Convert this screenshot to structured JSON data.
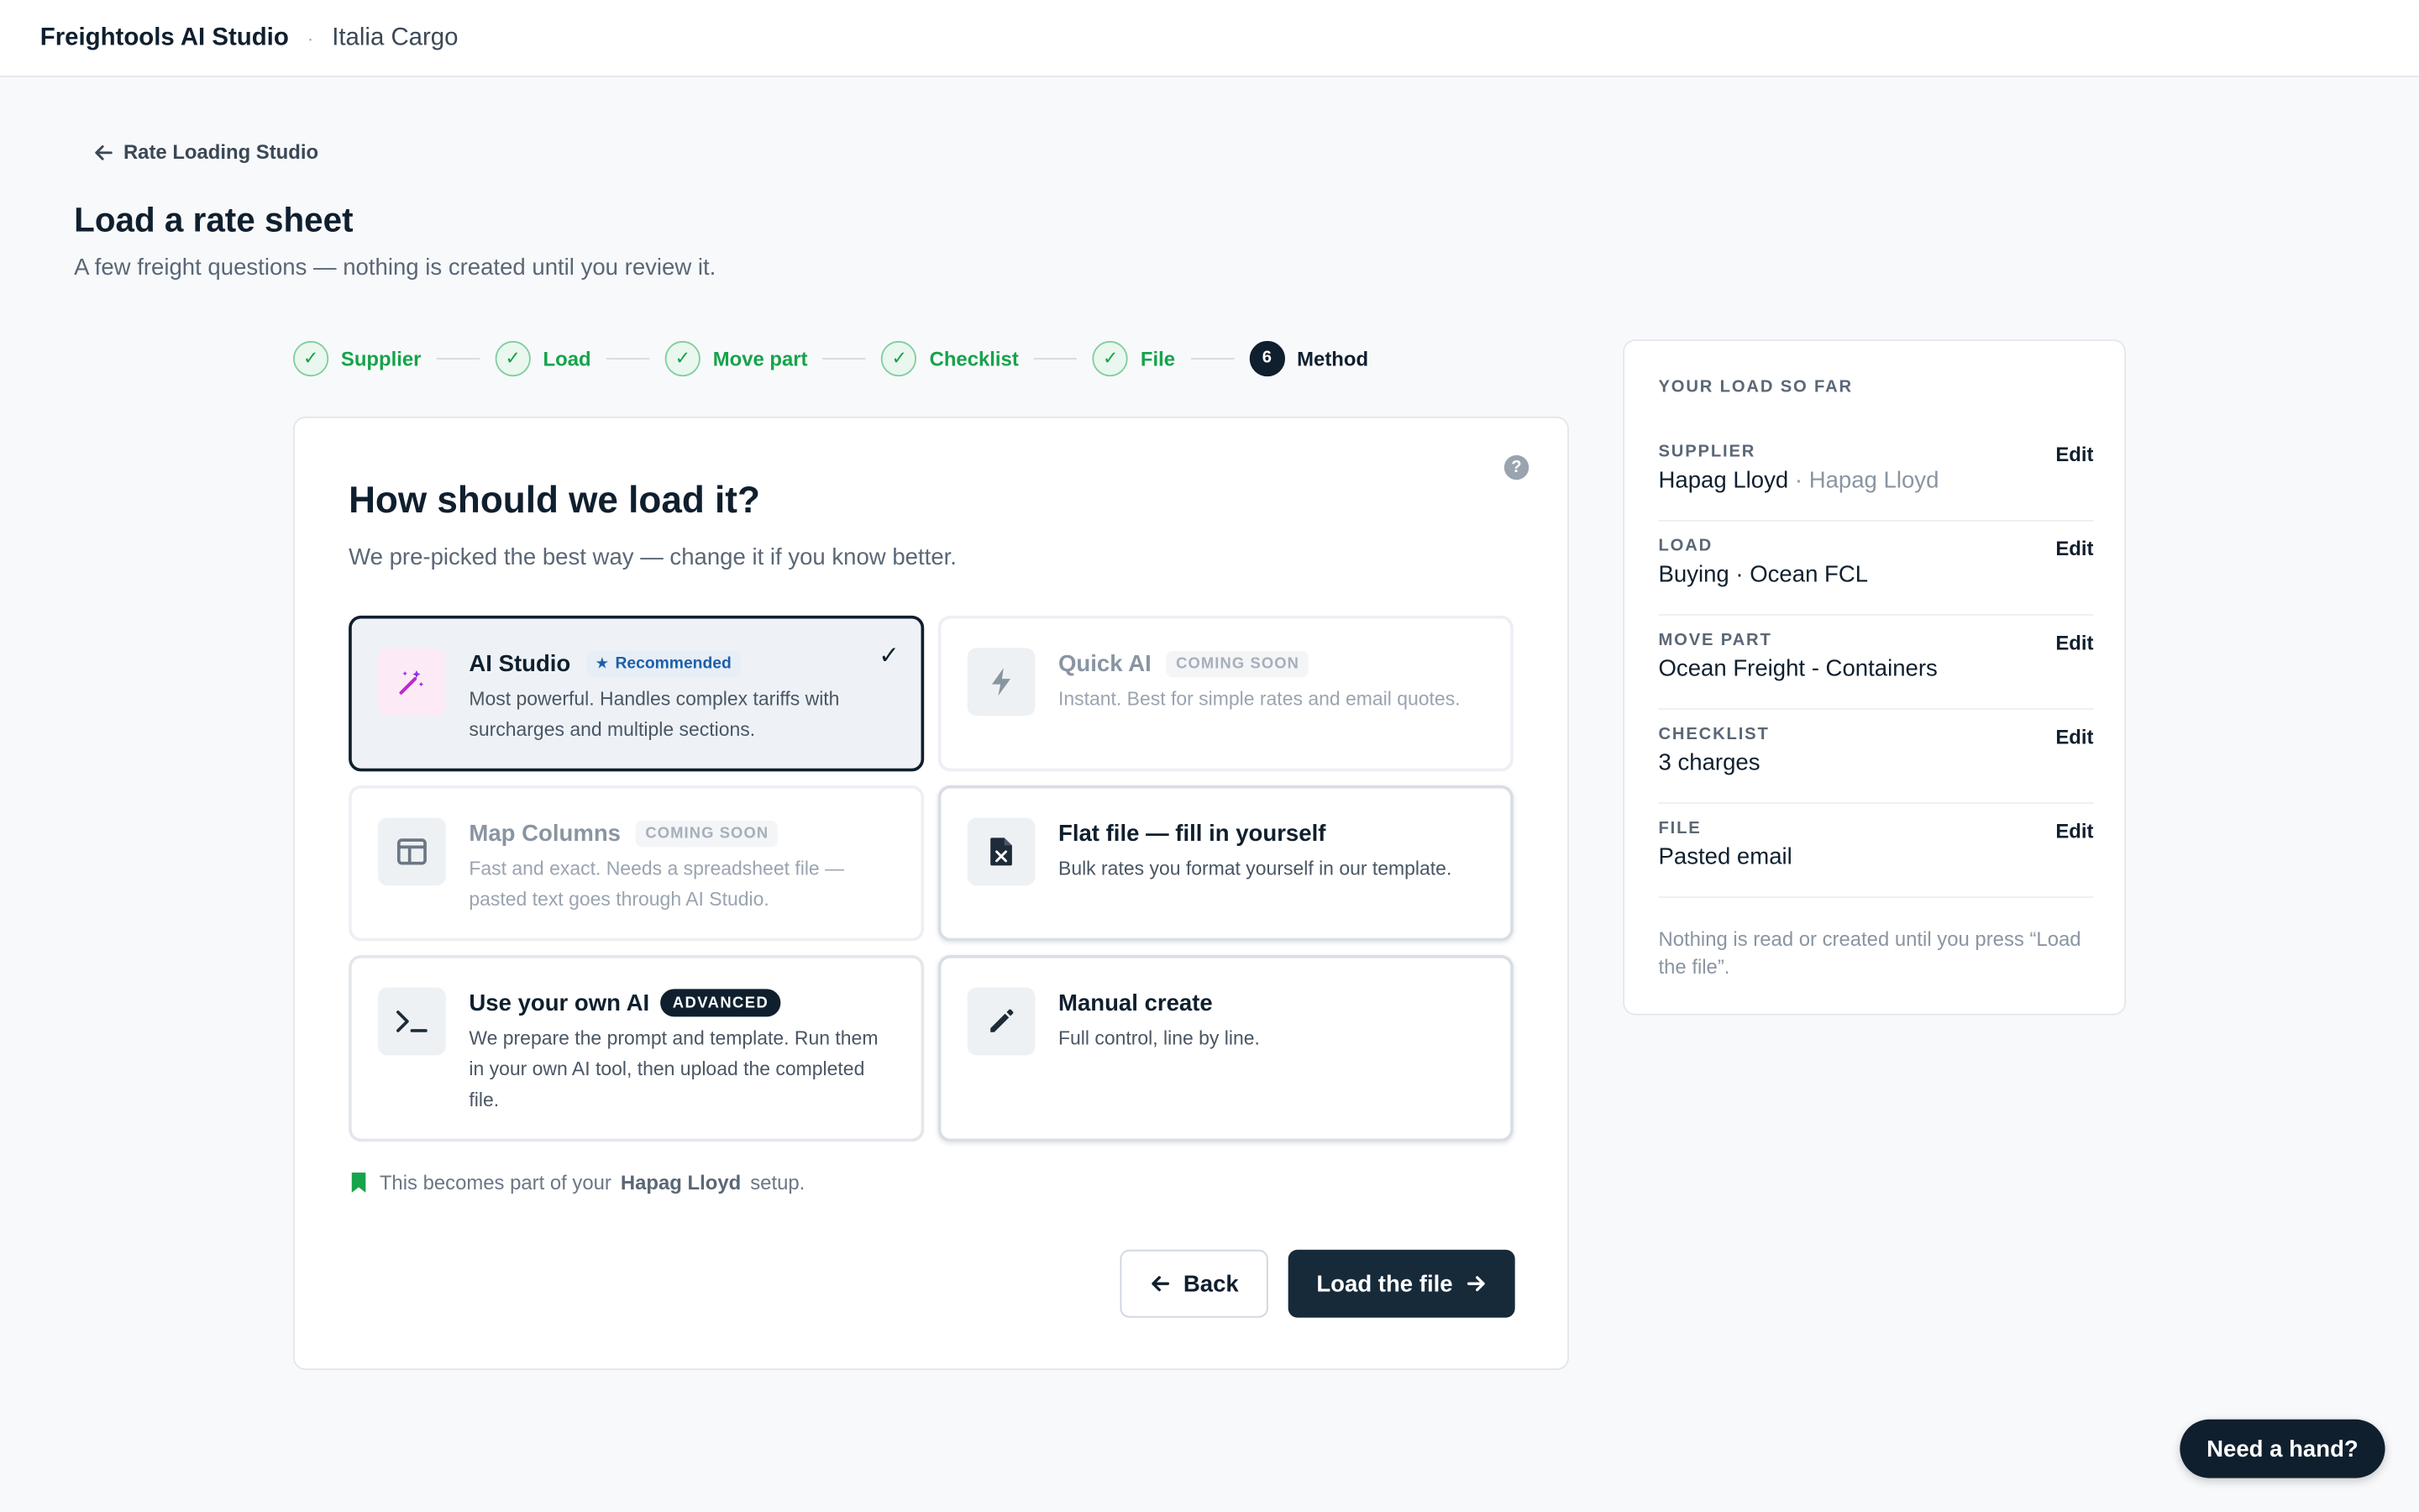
{
  "topbar": {
    "brand": "Freightools AI Studio",
    "separator": "·",
    "org": "Italia Cargo"
  },
  "nav": {
    "back_label": "Rate Loading Studio"
  },
  "page": {
    "title": "Load a rate sheet",
    "subtitle": "A few freight questions — nothing is created until you review it."
  },
  "stepper": {
    "steps": [
      {
        "label": "Supplier",
        "state": "done"
      },
      {
        "label": "Load",
        "state": "done"
      },
      {
        "label": "Move part",
        "state": "done"
      },
      {
        "label": "Checklist",
        "state": "done"
      },
      {
        "label": "File",
        "state": "done"
      },
      {
        "label": "Method",
        "state": "active",
        "number": "6"
      }
    ]
  },
  "card": {
    "title": "How should we load it?",
    "subtitle": "We pre-picked the best way — change it if you know better.",
    "help": "?",
    "options": [
      {
        "name": "AI Studio",
        "tag": "Recommended",
        "desc": "Most powerful. Handles complex tariffs with surcharges and multiple sections.",
        "icon": "magic-wand-icon",
        "selected": true
      },
      {
        "name": "Quick AI",
        "tag": "COMING SOON",
        "desc": "Instant. Best for simple rates and email quotes.",
        "icon": "lightning-icon"
      },
      {
        "name": "Map Columns",
        "tag": "COMING SOON",
        "desc": "Fast and exact. Needs a spreadsheet file — pasted text goes through AI Studio.",
        "icon": "columns-icon"
      },
      {
        "name": "Flat file — fill in yourself",
        "tag": "",
        "desc": "Bulk rates you format yourself in our template.",
        "icon": "excel-file-icon"
      },
      {
        "name": "Use your own AI",
        "tag": "ADVANCED",
        "desc": "We prepare the prompt and template. Run them in your own AI tool, then upload the completed file.",
        "icon": "terminal-icon"
      },
      {
        "name": "Manual create",
        "tag": "",
        "desc": "Full control, line by line.",
        "icon": "pencil-icon"
      }
    ],
    "note": {
      "before": "This becomes part of your",
      "supplier": "Hapag Lloyd",
      "after": "setup."
    },
    "back_label": "Back",
    "load_label": "Load the file"
  },
  "summary": {
    "heading": "YOUR LOAD SO FAR",
    "edit_label": "Edit",
    "rows": [
      {
        "label": "SUPPLIER",
        "value": "Hapag Lloyd",
        "muted": "· Hapag Lloyd"
      },
      {
        "label": "LOAD",
        "value": "Buying · Ocean FCL"
      },
      {
        "label": "MOVE PART",
        "value": "Ocean Freight - Containers"
      },
      {
        "label": "CHECKLIST",
        "value": "3 charges"
      },
      {
        "label": "FILE",
        "value": "Pasted email"
      }
    ],
    "footer": "Nothing is read or created until you press “Load the file”."
  },
  "help_pill": "Need a hand?",
  "colors": {
    "accent_dark": "#0f1f2e",
    "success": "#16a34a",
    "link_blue": "#1d5fa8"
  }
}
